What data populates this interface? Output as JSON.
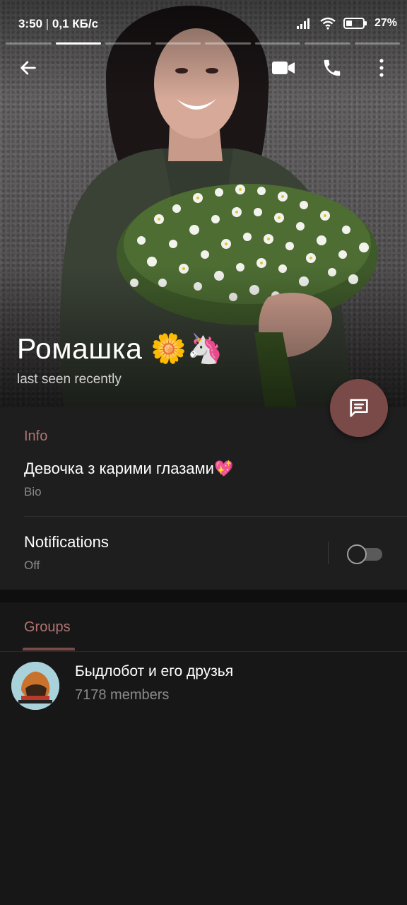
{
  "status_bar": {
    "time": "3:50",
    "network_speed": "0,1 КБ/с",
    "battery_percent": "27%",
    "icons": [
      "signal-icon",
      "wifi-icon",
      "battery-icon"
    ]
  },
  "stories": {
    "segments": 7,
    "active_index": 0
  },
  "toolbar": {
    "back_icon": "arrow-left-icon",
    "video_icon": "video-camera-icon",
    "call_icon": "phone-icon",
    "menu_icon": "more-vertical-icon"
  },
  "profile": {
    "name": "Ромашка 🌼🦄",
    "last_seen": "last seen recently"
  },
  "fab": {
    "icon": "message-icon"
  },
  "info": {
    "title": "Info",
    "bio": "Девочка з карими глазами💖",
    "bio_label": "Bio",
    "notifications_title": "Notifications",
    "notifications_state": "Off",
    "notifications_enabled": false
  },
  "groups": {
    "title": "Groups",
    "items": [
      {
        "name": "Быдлобот и его друзья",
        "members": "7178 members"
      }
    ]
  },
  "colors": {
    "accent": "#b07472",
    "fab": "#7a4a48",
    "background": "#171717",
    "section_bg": "#1e1e1e"
  }
}
